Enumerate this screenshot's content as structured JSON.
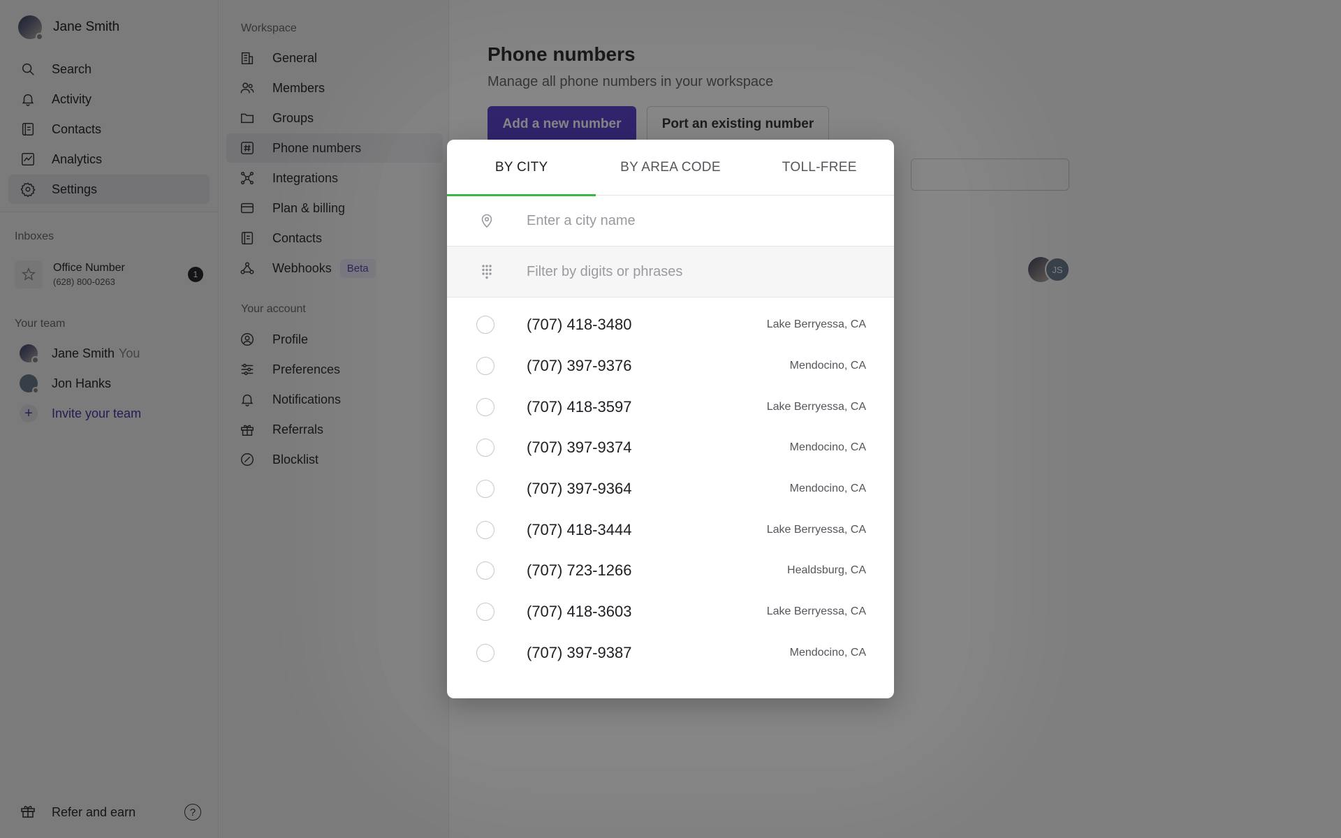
{
  "sidebar": {
    "user_name": "Jane Smith",
    "nav": [
      {
        "label": "Search",
        "icon": "search-icon"
      },
      {
        "label": "Activity",
        "icon": "bell-icon"
      },
      {
        "label": "Contacts",
        "icon": "contacts-icon"
      },
      {
        "label": "Analytics",
        "icon": "analytics-icon"
      },
      {
        "label": "Settings",
        "icon": "gear-icon"
      }
    ],
    "inboxes_label": "Inboxes",
    "inbox": {
      "name": "Office Number",
      "number": "(628) 800-0263",
      "badge": "1"
    },
    "team_label": "Your team",
    "team": [
      {
        "name": "Jane Smith",
        "suffix": "You"
      },
      {
        "name": "Jon Hanks"
      }
    ],
    "invite_label": "Invite your team",
    "refer_label": "Refer and earn",
    "help_glyph": "?"
  },
  "settings": {
    "workspace_label": "Workspace",
    "workspace_items": [
      {
        "label": "General"
      },
      {
        "label": "Members"
      },
      {
        "label": "Groups"
      },
      {
        "label": "Phone numbers"
      },
      {
        "label": "Integrations"
      },
      {
        "label": "Plan & billing"
      },
      {
        "label": "Contacts"
      },
      {
        "label": "Webhooks",
        "badge": "Beta"
      }
    ],
    "account_label": "Your account",
    "account_items": [
      {
        "label": "Profile"
      },
      {
        "label": "Preferences"
      },
      {
        "label": "Notifications"
      },
      {
        "label": "Referrals"
      },
      {
        "label": "Blocklist"
      }
    ]
  },
  "main": {
    "title": "Phone numbers",
    "subtitle": "Manage all phone numbers in your workspace",
    "add_button": "Add a new number",
    "port_button": "Port an existing number",
    "avatar_initials": "JS"
  },
  "modal": {
    "tabs": [
      "BY CITY",
      "BY AREA CODE",
      "TOLL-FREE"
    ],
    "active_tab": "BY CITY",
    "city_placeholder": "Enter a city name",
    "filter_placeholder": "Filter by digits or phrases",
    "numbers": [
      {
        "number": "(707) 418-3480",
        "city": "Lake Berryessa, CA"
      },
      {
        "number": "(707) 397-9376",
        "city": "Mendocino, CA"
      },
      {
        "number": "(707) 418-3597",
        "city": "Lake Berryessa, CA"
      },
      {
        "number": "(707) 397-9374",
        "city": "Mendocino, CA"
      },
      {
        "number": "(707) 397-9364",
        "city": "Mendocino, CA"
      },
      {
        "number": "(707) 418-3444",
        "city": "Lake Berryessa, CA"
      },
      {
        "number": "(707) 723-1266",
        "city": "Healdsburg, CA"
      },
      {
        "number": "(707) 418-3603",
        "city": "Lake Berryessa, CA"
      },
      {
        "number": "(707) 397-9387",
        "city": "Mendocino, CA"
      }
    ]
  },
  "colors": {
    "accent": "#4b2fc9",
    "tab_underline": "#3cb54a",
    "overlay": "rgba(0,0,0,0.5)"
  }
}
